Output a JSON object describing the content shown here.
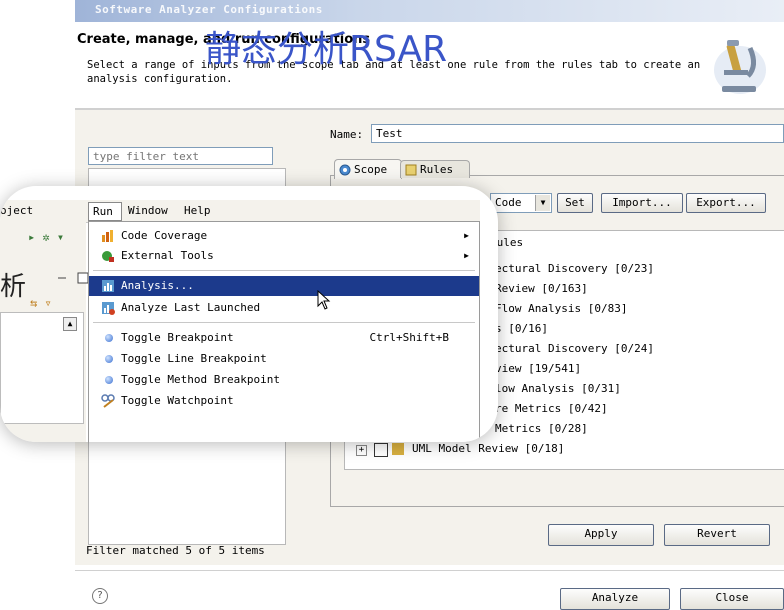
{
  "window": {
    "title": "Software Analyzer Configurations",
    "heading": "Create, manage, and run configurations",
    "description": "Select a range of inputs from the scope tab and at least one rule from the rules tab to create an analysis configuration.",
    "overlay_title": "静态分析RSAR"
  },
  "left": {
    "filter_placeholder": "type filter text",
    "status": "Filter matched 5 of 5 items"
  },
  "form": {
    "name_label": "Name:",
    "name_value": "Test"
  },
  "tabs": [
    {
      "label": "Scope"
    },
    {
      "label": "Rules"
    }
  ],
  "rules": {
    "combo_value": "Code",
    "set_label": "Set",
    "import_label": "Import...",
    "export_label": "Export...",
    "header": "Rules",
    "items": [
      "ectural Discovery [0/23]",
      "Review [0/163]",
      "Flow Analysis [0/83]",
      "s [0/16]",
      "ectural Discovery [0/24]",
      "view [19/541]",
      "low Analysis [0/31]",
      "re Metrics [0/42]",
      "Metrics [0/28]",
      "UML Model Review [0/18]"
    ]
  },
  "buttons": {
    "apply": "Apply",
    "revert": "Revert",
    "analyze": "Analyze",
    "close": "Close"
  },
  "menubar": {
    "project": "oject",
    "run": "Run",
    "window": "Window",
    "help": "Help"
  },
  "run_menu": {
    "items": [
      {
        "label": "Code Coverage",
        "icon": "code-coverage-icon"
      },
      {
        "label": "External Tools",
        "icon": "external-tools-icon"
      },
      {
        "label": "Analysis...",
        "icon": "analysis-icon"
      },
      {
        "label": "Analyze Last Launched",
        "icon": "analyze-last-icon"
      },
      {
        "label": "Toggle Breakpoint",
        "accelerator": "Ctrl+Shift+B"
      },
      {
        "label": "Toggle Line Breakpoint"
      },
      {
        "label": "Toggle Method Breakpoint"
      },
      {
        "label": "Toggle Watchpoint",
        "icon": "watchpoint-icon"
      }
    ]
  },
  "cut_char": "析",
  "help_glyph": "?",
  "colors": {
    "highlight": "#1c3a8c",
    "overlay_title": "#3a55c8"
  }
}
